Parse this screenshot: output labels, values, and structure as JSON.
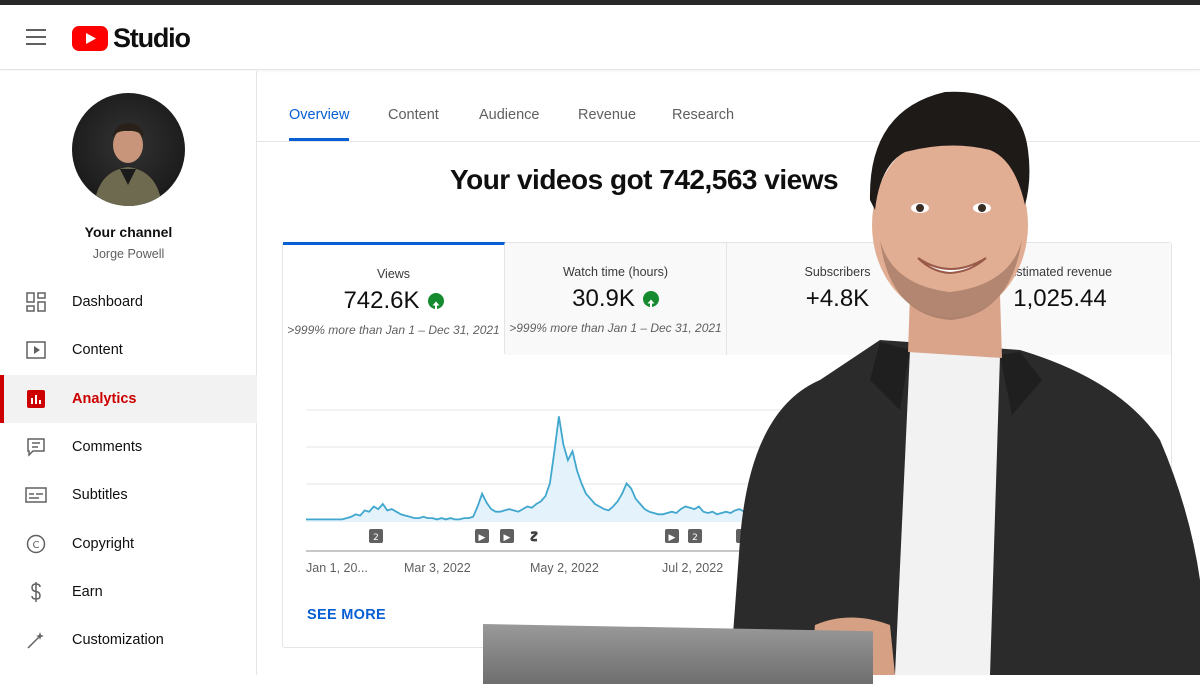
{
  "header": {
    "logo_text": "Studio"
  },
  "sidebar": {
    "channel_title": "Your channel",
    "channel_name": "Jorge Powell",
    "items": [
      {
        "label": "Dashboard",
        "icon": "dashboard-icon"
      },
      {
        "label": "Content",
        "icon": "content-icon"
      },
      {
        "label": "Analytics",
        "icon": "analytics-icon",
        "active": true
      },
      {
        "label": "Comments",
        "icon": "comments-icon"
      },
      {
        "label": "Subtitles",
        "icon": "subtitles-icon"
      },
      {
        "label": "Copyright",
        "icon": "copyright-icon"
      },
      {
        "label": "Earn",
        "icon": "earn-icon"
      },
      {
        "label": "Customization",
        "icon": "customization-icon"
      }
    ]
  },
  "tabs": [
    {
      "label": "Overview",
      "active": true
    },
    {
      "label": "Content"
    },
    {
      "label": "Audience"
    },
    {
      "label": "Revenue"
    },
    {
      "label": "Research"
    }
  ],
  "headline": "Your videos got 742,563 views",
  "metrics": [
    {
      "label": "Views",
      "value": "742.6K",
      "trend": "up",
      "compare": ">999% more than Jan 1 – Dec 31, 2021"
    },
    {
      "label": "Watch time (hours)",
      "value": "30.9K",
      "trend": "up",
      "compare": ">999% more than Jan 1 – Dec 31, 2021"
    },
    {
      "label": "Subscribers",
      "value": "+4.8K"
    },
    {
      "label": "Estimated revenue",
      "value": "1,025.44"
    }
  ],
  "chart_data": {
    "type": "area",
    "x_ticks": [
      "Jan 1, 20...",
      "Mar 3, 2022",
      "May 2, 2022",
      "Jul 2, 2022"
    ],
    "markers": [
      "2",
      "▶",
      "▶",
      "",
      "▶",
      "2",
      "2"
    ],
    "series": [
      {
        "values": [
          2,
          2,
          2,
          2,
          2,
          2,
          2,
          2,
          2,
          3,
          4,
          6,
          5,
          9,
          8,
          12,
          10,
          14,
          9,
          10,
          8,
          6,
          5,
          4,
          3,
          3,
          4,
          3,
          3,
          2,
          3,
          2,
          3,
          2,
          2,
          3,
          3,
          4,
          12,
          22,
          15,
          10,
          8,
          8,
          9,
          10,
          9,
          8,
          10,
          12,
          11,
          14,
          16,
          20,
          30,
          55,
          82,
          60,
          48,
          55,
          40,
          30,
          22,
          18,
          14,
          12,
          10,
          9,
          12,
          16,
          22,
          30,
          26,
          18,
          14,
          10,
          8,
          7,
          6,
          6,
          7,
          8,
          7,
          10,
          12,
          11,
          10,
          12,
          8,
          7,
          8,
          6,
          7,
          8,
          7,
          9,
          10,
          8,
          9,
          10,
          12,
          15,
          13,
          11,
          12,
          14,
          16,
          20,
          28,
          40,
          58,
          40,
          28,
          20,
          18,
          22,
          18,
          20,
          15,
          16,
          14,
          15,
          20,
          22,
          18
        ]
      }
    ],
    "ylim": [
      0,
      100
    ]
  },
  "see_more": "SEE MORE"
}
